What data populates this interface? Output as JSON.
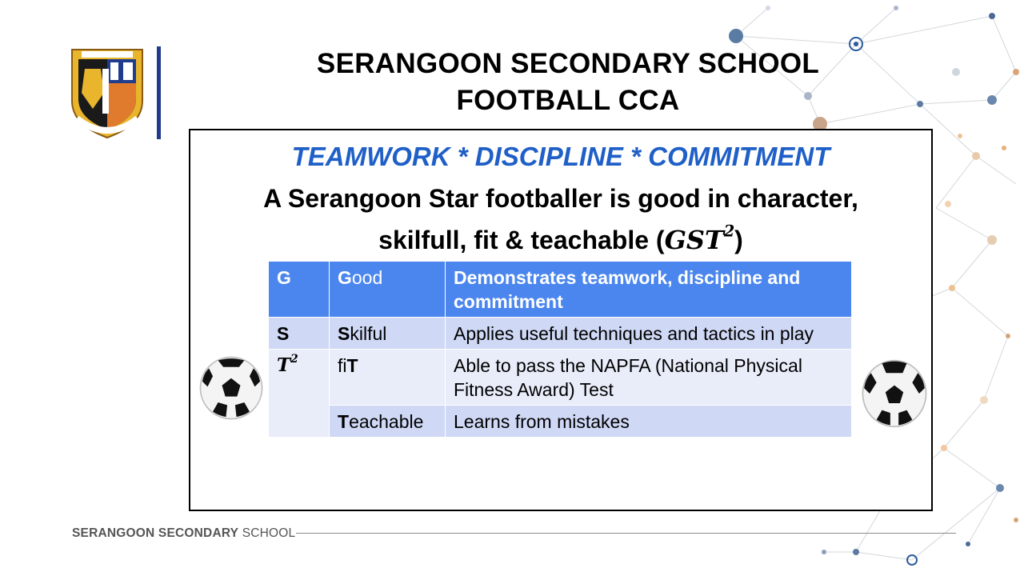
{
  "header": {
    "title_line1": "SERANGOON SECONDARY SCHOOL",
    "title_line2": "FOOTBALL CCA"
  },
  "card": {
    "values": "TEAMWORK * DISCIPLINE * COMMITMENT",
    "statement_line1": "A Serangoon Star footballer is good in character,",
    "statement_line2_prefix": "skilfull, fit & teachable (",
    "statement_math": "GST",
    "statement_exp": "2",
    "statement_suffix": ")"
  },
  "table": {
    "rows": [
      {
        "letter": "G",
        "word_bold": "G",
        "word_rest": "ood",
        "desc": "Demonstrates teamwork, discipline and commitment"
      },
      {
        "letter": "S",
        "word_bold": "S",
        "word_rest": "kilful",
        "desc": "Applies useful techniques and tactics in play"
      },
      {
        "letter": "T",
        "letter_exp": "2",
        "word_pre": "fi",
        "word_bold": "T",
        "desc": "Able to pass the NAPFA (National Physical Fitness Award) Test"
      },
      {
        "word_bold": "T",
        "word_rest": "eachable",
        "desc": "Learns from mistakes"
      }
    ]
  },
  "footer": {
    "bold": "SERANGOON SECONDARY",
    "light": " SCHOOL"
  },
  "colors": {
    "accent_blue": "#1f5fc7",
    "table_header": "#4b86ee",
    "table_row_dark": "#cfd8f5",
    "table_row_light": "#e9edfa"
  }
}
